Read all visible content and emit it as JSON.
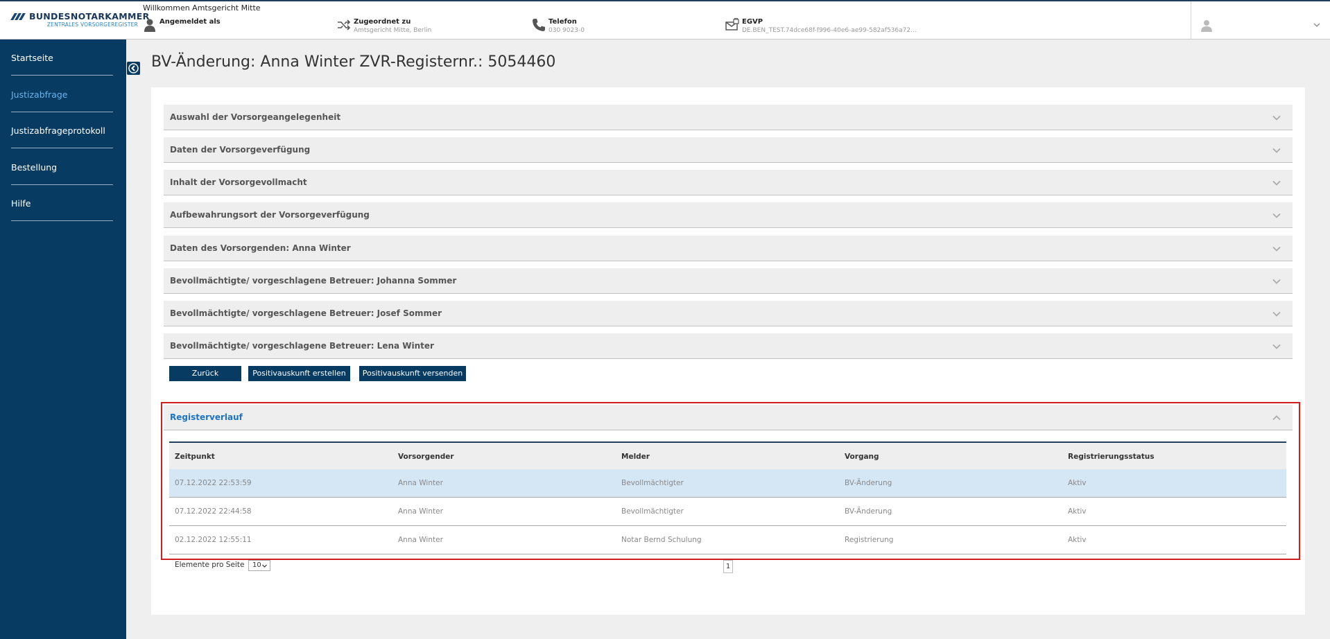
{
  "header": {
    "logo_name": "BUNDESNOTARKAMMER",
    "logo_sub": "ZENTRALES VORSORGEREGISTER",
    "welcome": "Willkommen Amtsgericht Mitte",
    "logged_in_label": "Angemeldet als",
    "logged_in_value": "",
    "assigned_label": "Zugeordnet zu",
    "assigned_value": "Amtsgericht Mitte, Berlin",
    "phone_label": "Telefon",
    "phone_value": "030 9023-0",
    "egvp_label": "EGVP",
    "egvp_value": "DE.BEN_TEST.74dce68f-f996-40e6-ae99-582af536a72..."
  },
  "sidebar": {
    "items": [
      {
        "label": "Startseite"
      },
      {
        "label": "Justizabfrage"
      },
      {
        "label": "Justizabfrageprotokoll"
      },
      {
        "label": "Bestellung"
      },
      {
        "label": "Hilfe"
      }
    ]
  },
  "page": {
    "title": "BV-Änderung: Anna Winter ZVR-Registernr.: 5054460"
  },
  "accordion": [
    {
      "label": "Auswahl der Vorsorgeangelegenheit"
    },
    {
      "label": "Daten der Vorsorgeverfügung"
    },
    {
      "label": "Inhalt der Vorsorgevollmacht"
    },
    {
      "label": "Aufbewahrungsort der Vorsorgeverfügung"
    },
    {
      "label": "Daten des Vorsorgenden: Anna Winter"
    },
    {
      "label": "Bevollmächtigte/ vorgeschlagene Betreuer: Johanna Sommer"
    },
    {
      "label": "Bevollmächtigte/ vorgeschlagene Betreuer: Josef Sommer"
    },
    {
      "label": "Bevollmächtigte/ vorgeschlagene Betreuer: Lena Winter"
    }
  ],
  "buttons": {
    "back": "Zurück",
    "create": "Positivauskunft erstellen",
    "send": "Positivauskunft versenden"
  },
  "register": {
    "title": "Registerverlauf",
    "columns": [
      "Zeitpunkt",
      "Vorsorgender",
      "Melder",
      "Vorgang",
      "Registrierungsstatus"
    ],
    "rows": [
      [
        "07.12.2022 22:53:59",
        "Anna Winter",
        "Bevollmächtigter",
        "BV-Änderung",
        "Aktiv"
      ],
      [
        "07.12.2022 22:44:58",
        "Anna Winter",
        "Bevollmächtigter",
        "BV-Änderung",
        "Aktiv"
      ],
      [
        "02.12.2022 12:55:11",
        "Anna Winter",
        "Notar Bernd Schulung",
        "Registrierung",
        "Aktiv"
      ]
    ]
  },
  "pager": {
    "label": "Elemente pro Seite",
    "page_size": "10",
    "current_page": "1"
  },
  "colors": {
    "brand_navy": "#073b62",
    "active_link": "#6cb4ec",
    "highlight_border": "#cc1f1f",
    "selected_row": "#d5e6f5"
  }
}
